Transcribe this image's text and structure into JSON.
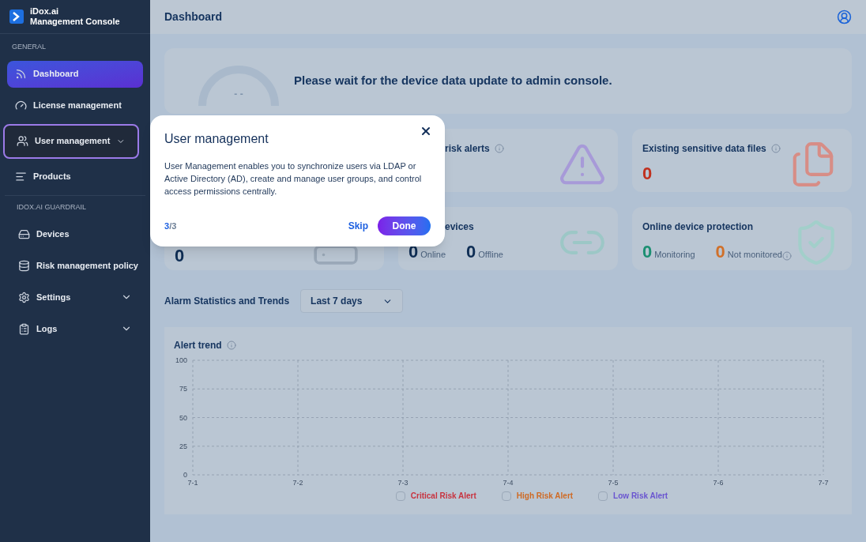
{
  "sidebar": {
    "brand": {
      "name": "iDox.ai",
      "subtitle": "Management Console"
    },
    "sections": [
      {
        "label": "GENERAL",
        "items": [
          {
            "label": "Dashboard",
            "selected": true,
            "highlighted": false,
            "expandable": false
          },
          {
            "label": "License management",
            "selected": false,
            "highlighted": false,
            "expandable": false
          },
          {
            "label": "User management",
            "selected": false,
            "highlighted": true,
            "expandable": true
          },
          {
            "label": "Products",
            "selected": false,
            "highlighted": false,
            "expandable": false
          }
        ]
      },
      {
        "label": "IDOX.AI GUARDRAIL",
        "items": [
          {
            "label": "Devices",
            "selected": false,
            "highlighted": false,
            "expandable": false
          },
          {
            "label": "Risk management policy",
            "selected": false,
            "highlighted": false,
            "expandable": false
          },
          {
            "label": "Settings",
            "selected": false,
            "highlighted": false,
            "expandable": true
          },
          {
            "label": "Logs",
            "selected": false,
            "highlighted": false,
            "expandable": true
          }
        ]
      }
    ]
  },
  "header": {
    "title": "Dashboard"
  },
  "banner": {
    "reading": "- -",
    "message": "Please wait for the device data update to admin console."
  },
  "stat_cards": [
    {
      "kind": "warning",
      "title": "risk alerts",
      "info": true,
      "title_clipped": true
    },
    {
      "kind": "file",
      "title": "Existing sensitive data files",
      "info": true,
      "title_clipped": false,
      "values": [
        {
          "value": "0",
          "color": "#c0311f"
        }
      ]
    },
    {
      "kind": "device",
      "values": [
        {
          "value": "0",
          "color": "#0f2e55"
        }
      ]
    },
    {
      "kind": "links",
      "title": "evices",
      "title_clipped": true,
      "values": [
        {
          "value": "0",
          "label": "Online",
          "color": "#0f2e55"
        },
        {
          "value": "0",
          "label": "Offline",
          "color": "#0f2e55"
        }
      ]
    },
    {
      "kind": "shield",
      "title": "Online device protection",
      "title_clipped": false,
      "values": [
        {
          "value": "0",
          "label": "Monitoring",
          "color": "#1c8f72",
          "info": false
        },
        {
          "value": "0",
          "label": "Not monitored",
          "color": "#d0702a",
          "info": true
        }
      ]
    }
  ],
  "alarms": {
    "title": "Alarm Statistics and Trends",
    "range": "Last 7 days",
    "chart": {
      "title": "Alert trend",
      "info": true,
      "legend": [
        {
          "checked": false
        },
        {
          "checked": false
        },
        {
          "checked": false
        }
      ],
      "chart_data": {
        "type": "line",
        "grid": true,
        "categories": [
          "7-1",
          "7-2",
          "7-3",
          "7-4",
          "7-5",
          "7-6",
          "7-7"
        ],
        "ylim": [
          0,
          100
        ],
        "yticks": [
          0,
          25,
          50,
          75,
          100
        ],
        "series": [
          {
            "name": "Critical Risk Alert",
            "color": "#c8333f",
            "values": [
              null,
              null,
              null,
              null,
              null,
              null,
              null
            ]
          },
          {
            "name": "High Risk Alert",
            "color": "#cf6a24",
            "values": [
              null,
              null,
              null,
              null,
              null,
              null,
              null
            ]
          },
          {
            "name": "Low Risk Alert",
            "color": "#6a55d0",
            "values": [
              null,
              null,
              null,
              null,
              null,
              null,
              null
            ]
          }
        ]
      }
    }
  },
  "tour": {
    "title": "User management",
    "body": "User Management enables you to synchronize users via LDAP or Active Directory (AD), create and manage user groups, and control access permissions centrally.",
    "current": "3",
    "rest": "/3",
    "skip": "Skip",
    "done": "Done"
  }
}
